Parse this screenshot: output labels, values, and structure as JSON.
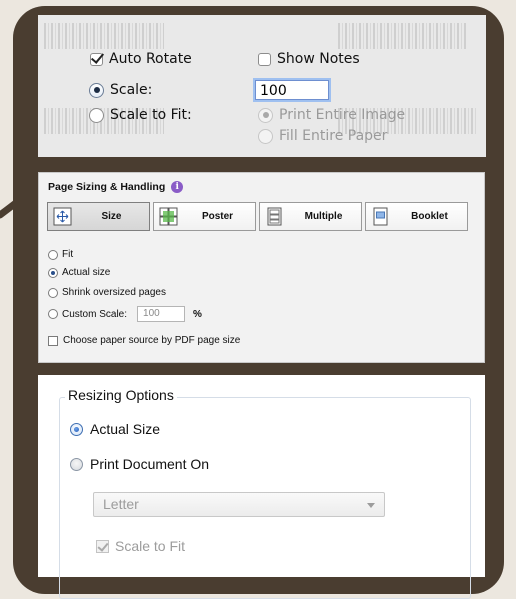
{
  "mac_dialog": {
    "auto_rotate_label": "Auto Rotate",
    "auto_rotate_checked": true,
    "show_notes_label": "Show Notes",
    "show_notes_checked": false,
    "scale_label": "Scale:",
    "scale_value": "100",
    "scale_to_fit_label": "Scale to Fit:",
    "print_entire_image_label": "Print Entire Image",
    "fill_entire_paper_label": "Fill Entire Paper"
  },
  "page_sizing": {
    "title": "Page Sizing & Handling",
    "info_icon": "i",
    "tabs": [
      {
        "label": "Size",
        "icon": "size-icon",
        "active": true
      },
      {
        "label": "Poster",
        "icon": "poster-icon",
        "active": false
      },
      {
        "label": "Multiple",
        "icon": "multiple-icon",
        "active": false
      },
      {
        "label": "Booklet",
        "icon": "booklet-icon",
        "active": false
      }
    ],
    "fit_label": "Fit",
    "actual_size_label": "Actual size",
    "shrink_label": "Shrink oversized pages",
    "custom_scale_label": "Custom Scale:",
    "custom_scale_value": "100",
    "percent_sign": "%",
    "paper_source_label": "Choose paper source by PDF page size",
    "selected_option": "Actual size"
  },
  "resizing": {
    "group_title": "Resizing Options",
    "actual_size_label": "Actual Size",
    "print_document_on_label": "Print Document On",
    "paper_select_value": "Letter",
    "scale_to_fit_label": "Scale to Fit",
    "selected_option": "Actual Size"
  },
  "colors": {
    "frame": "#4a3d30",
    "page_background": "#ece7df",
    "accent_info": "#8a5cc7"
  }
}
